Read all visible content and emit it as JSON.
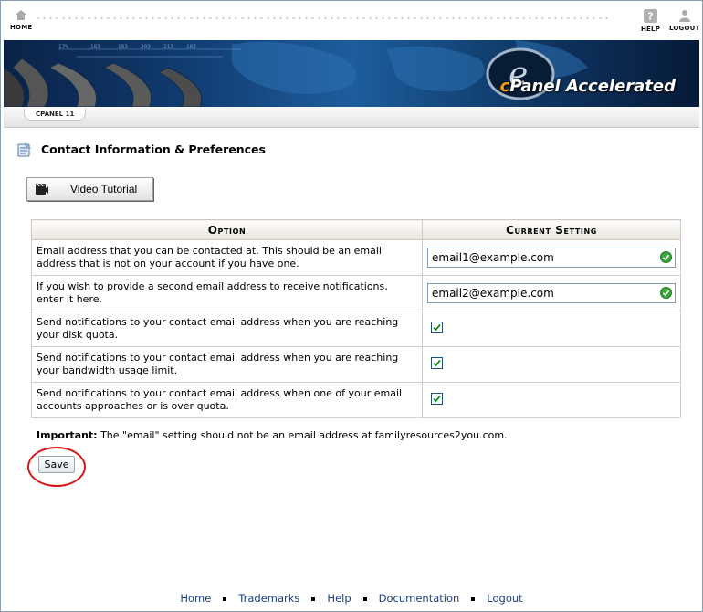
{
  "topbar": {
    "home_label": "HOME",
    "help_label": "HELP",
    "logout_label": "LOGOUT"
  },
  "banner": {
    "brand_c": "c",
    "brand_text": "Panel Accelerated"
  },
  "version": {
    "label": "CPANEL 11"
  },
  "page": {
    "title": "Contact Information & Preferences"
  },
  "video": {
    "label": "Video Tutorial"
  },
  "table": {
    "headers": [
      "Option",
      "Current Setting"
    ],
    "rows": [
      {
        "option": "Email address that you can be contacted at. This should be an email address that is not on your account if you have one.",
        "value": "email1@example.com"
      },
      {
        "option": "If you wish to provide a second email address to receive notifications, enter it here.",
        "value": "email2@example.com"
      },
      {
        "option": "Send notifications to your contact email address when you are reaching your disk quota.",
        "checked": true
      },
      {
        "option": "Send notifications to your contact email address when you are reaching your bandwidth usage limit.",
        "checked": true
      },
      {
        "option": "Send notifications to your contact email address when one of your email accounts approaches or is over quota.",
        "checked": true
      }
    ]
  },
  "important": {
    "label": "Important:",
    "text": " The \"email\" setting should not be an email address at familyresources2you.com."
  },
  "save": {
    "label": "Save"
  },
  "footer": {
    "links": [
      "Home",
      "Trademarks",
      "Help",
      "Documentation",
      "Logout"
    ]
  },
  "colors": {
    "accent": "#1b3f82",
    "highlight_circle": "#d41818",
    "check_green": "#2e9b2e"
  }
}
